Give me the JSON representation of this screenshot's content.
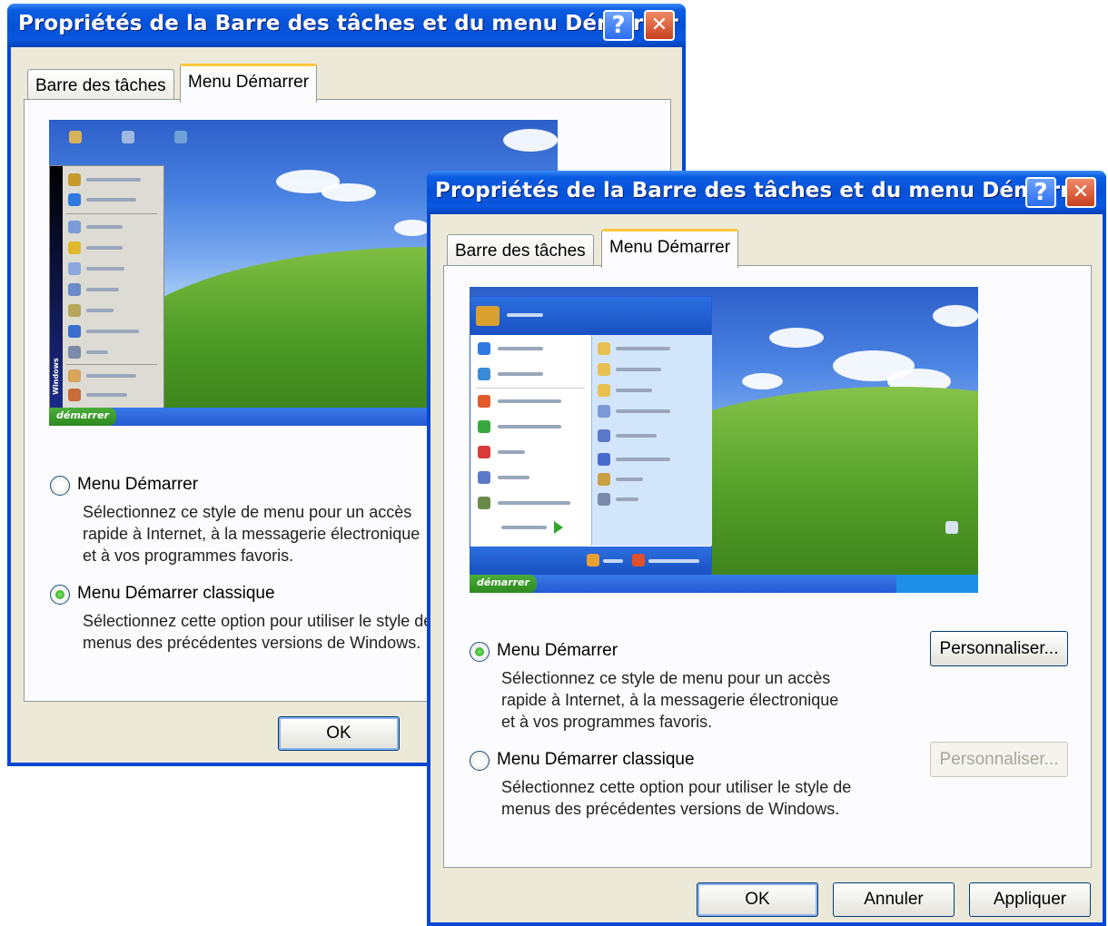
{
  "back_window": {
    "title": "Propriétés de la Barre des tâches et du menu Démarrer",
    "help_glyph": "?",
    "close_glyph": "✕",
    "tabs": [
      {
        "label": "Barre des tâches"
      },
      {
        "label": "Menu Démarrer"
      }
    ],
    "active_tab": "Menu Démarrer",
    "options": [
      {
        "label": "Menu Démarrer",
        "desc_lines": [
          "Sélectionnez ce style de menu pour un accès",
          "rapide à Internet, à la messagerie électronique",
          "et à vos programmes favoris."
        ],
        "selected": false
      },
      {
        "label": "Menu Démarrer classique",
        "desc_lines": [
          "Sélectionnez cette option pour utiliser le style de",
          "menus des précédentes versions de Windows."
        ],
        "selected": true
      }
    ],
    "buttons": {
      "ok": "OK"
    },
    "preview": {
      "start_label": "démarrer",
      "side_label": "Windows"
    }
  },
  "front_window": {
    "title": "Propriétés de la Barre des tâches et du menu Démarrer",
    "help_glyph": "?",
    "close_glyph": "✕",
    "tabs": [
      {
        "label": "Barre des tâches"
      },
      {
        "label": "Menu Démarrer"
      }
    ],
    "active_tab": "Menu Démarrer",
    "options": [
      {
        "label": "Menu Démarrer",
        "desc_lines": [
          "Sélectionnez ce style de menu pour un accès",
          "rapide à Internet, à la messagerie électronique",
          "et à vos programmes favoris."
        ],
        "selected": true,
        "customize": "Personnaliser...",
        "customize_enabled": true
      },
      {
        "label": "Menu Démarrer classique",
        "desc_lines": [
          "Sélectionnez cette option pour utiliser le style de",
          "menus des précédentes versions de Windows."
        ],
        "selected": false,
        "customize": "Personnaliser...",
        "customize_enabled": false
      }
    ],
    "buttons": {
      "ok": "OK",
      "cancel": "Annuler",
      "apply": "Appliquer"
    },
    "preview": {
      "start_label": "démarrer"
    }
  },
  "colors": {
    "title_blue": "#0651d6",
    "dialog_face": "#ece9d8",
    "tab_highlight": "#ffc83c",
    "close_red": "#c8401f",
    "radio_green": "#23a313"
  }
}
